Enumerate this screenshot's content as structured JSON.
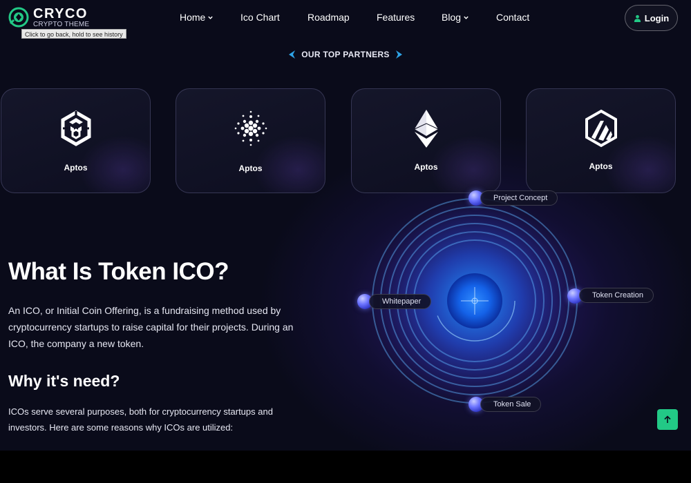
{
  "brand": {
    "name": "CRYCO",
    "tagline": "CRYPTO THEME",
    "accent_color": "#22c986"
  },
  "tooltip": "Click to go back, hold to see history",
  "nav": {
    "items": [
      {
        "label": "Home",
        "has_dropdown": true
      },
      {
        "label": "Ico Chart",
        "has_dropdown": false
      },
      {
        "label": "Roadmap",
        "has_dropdown": false
      },
      {
        "label": "Features",
        "has_dropdown": false
      },
      {
        "label": "Blog",
        "has_dropdown": true
      },
      {
        "label": "Contact",
        "has_dropdown": false
      }
    ],
    "login_label": "Login"
  },
  "partners": {
    "heading": "OUR TOP PARTNERS",
    "cards": [
      {
        "icon": "binance-icon",
        "label": "Aptos"
      },
      {
        "icon": "cardano-icon",
        "label": "Aptos"
      },
      {
        "icon": "ethereum-icon",
        "label": "Aptos"
      },
      {
        "icon": "arbitrum-icon",
        "label": "Aptos"
      }
    ]
  },
  "section": {
    "title": "What Is Token ICO?",
    "description": "An ICO, or Initial Coin Offering, is a fundraising method used by cryptocurrency startups to raise capital for their projects. During an ICO, the company a new token.",
    "subtitle": "Why it's need?",
    "subdescription": "ICOs serve several purposes, both for cryptocurrency startups and investors. Here are some reasons why ICOs are utilized:"
  },
  "orbit": {
    "nodes": [
      {
        "label": "Project Concept"
      },
      {
        "label": "Whitepaper"
      },
      {
        "label": "Token Creation"
      },
      {
        "label": "Token Sale"
      }
    ]
  }
}
